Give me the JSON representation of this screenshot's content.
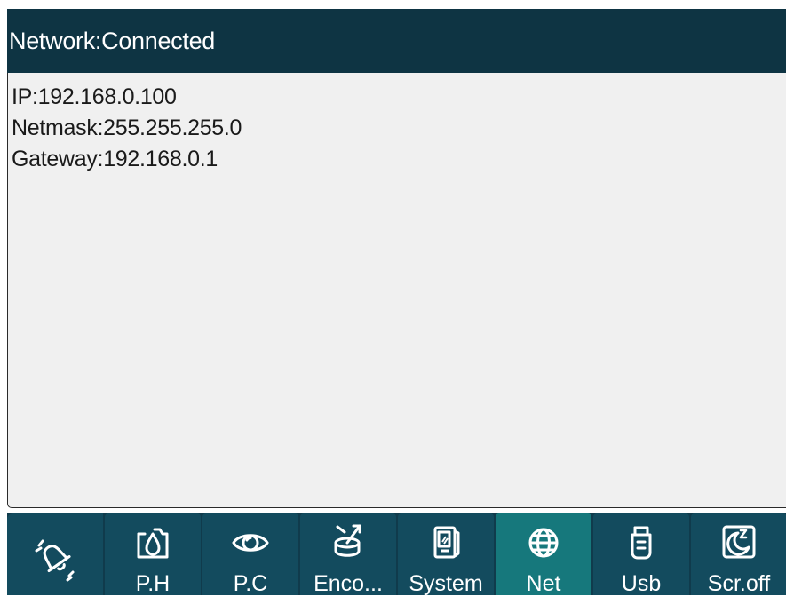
{
  "header": {
    "title": "Network:Connected"
  },
  "network_info": {
    "ip": "IP:192.168.0.100",
    "netmask": "Netmask:255.255.255.0",
    "gateway": "Gateway:192.168.0.1"
  },
  "tabs": [
    {
      "label": "",
      "icon": "alarm-bell-icon",
      "active": false
    },
    {
      "label": "P.H",
      "icon": "water-drop-icon",
      "active": false
    },
    {
      "label": "P.C",
      "icon": "eye-icon",
      "active": false
    },
    {
      "label": "Enco...",
      "icon": "encoder-icon",
      "active": false
    },
    {
      "label": "System",
      "icon": "device-icon",
      "active": false
    },
    {
      "label": "Net",
      "icon": "globe-icon",
      "active": true
    },
    {
      "label": "Usb",
      "icon": "usb-drive-icon",
      "active": false
    },
    {
      "label": "Scr.off",
      "icon": "moon-sleep-icon",
      "active": false
    }
  ],
  "colors": {
    "header_bg": "#0e3443",
    "tab_bg": "#134b5e",
    "tab_active_bg": "#16787c",
    "content_bg": "#f0f0f0"
  }
}
